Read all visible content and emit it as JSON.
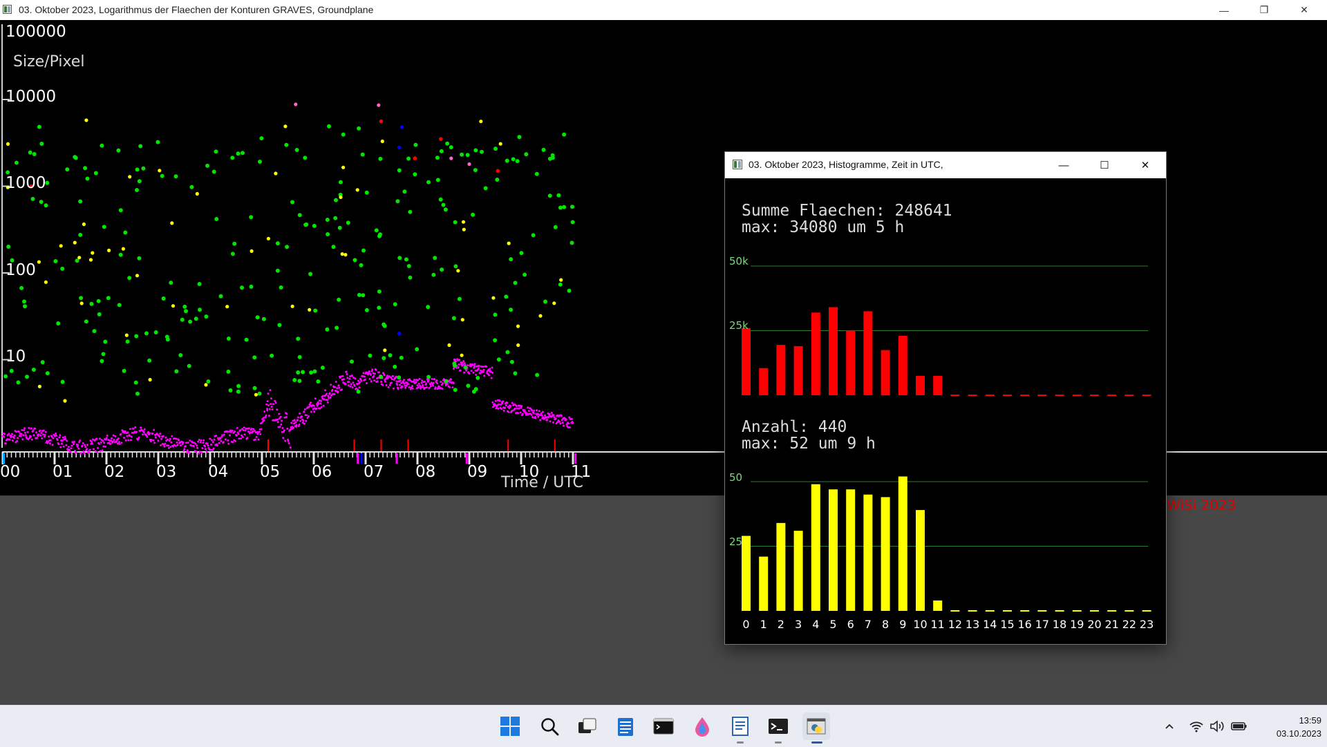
{
  "main_window": {
    "title": "03. Oktober 2023, Logarithmus der Flaechen der Konturen GRAVES, Groundplane",
    "buttons": {
      "minimize": "—",
      "restore": "❐",
      "close": "✕"
    }
  },
  "scatter_plot": {
    "y_tick_labels": [
      "100000",
      "10000",
      "1000",
      "100",
      "10"
    ],
    "y_axis_label": "Size/Pixel",
    "x_tick_labels": [
      "00",
      "01",
      "02",
      "03",
      "04",
      "05",
      "06",
      "07",
      "08",
      "09",
      "10",
      "11"
    ],
    "x_axis_label": "Time  /  UTC",
    "credit": "WiSi 2023",
    "colors": {
      "green": "#00e600",
      "yellow": "#ffff00",
      "magenta": "#ff00ff",
      "red": "#ff0000",
      "blue": "#0000ff",
      "pink": "#ff66cc"
    }
  },
  "hist_window": {
    "title": "03. Oktober 2023, Histogramme, Zeit in UTC,",
    "buttons": {
      "minimize": "—",
      "maximize": "☐",
      "close": "✕"
    },
    "sum_text": "Summe Flaechen: 248641",
    "sum_max_text": "max: 34080 um 5 h",
    "count_text": "Anzahl: 440",
    "count_max_text": "max: 52 um 9 h",
    "area_grid_labels": [
      "50k",
      "25k"
    ],
    "count_grid_labels": [
      "50",
      "25"
    ],
    "hour_labels": [
      "0",
      "1",
      "2",
      "3",
      "4",
      "5",
      "6",
      "7",
      "8",
      "9",
      "10",
      "11",
      "12",
      "13",
      "14",
      "15",
      "16",
      "17",
      "18",
      "19",
      "20",
      "21",
      "22",
      "23"
    ]
  },
  "chart_data": [
    {
      "type": "scatter",
      "title": "03. Oktober 2023, Logarithmus der Flaechen der Konturen GRAVES, Groundplane",
      "xlabel": "Time / UTC",
      "ylabel": "Size/Pixel",
      "ylim": [
        1,
        100000
      ],
      "yscale": "log",
      "xlim": [
        0,
        11.2
      ],
      "series": [
        {
          "name": "green",
          "color": "#00e600"
        },
        {
          "name": "yellow",
          "color": "#ffff00"
        },
        {
          "name": "magenta",
          "color": "#ff00ff"
        }
      ]
    },
    {
      "type": "bar",
      "title": "Summe Flaechen: 248641",
      "categories": [
        "0",
        "1",
        "2",
        "3",
        "4",
        "5",
        "6",
        "7",
        "8",
        "9",
        "10",
        "11",
        "12",
        "13",
        "14",
        "15",
        "16",
        "17",
        "18",
        "19",
        "20",
        "21",
        "22",
        "23"
      ],
      "values": [
        26000,
        10500,
        19500,
        19000,
        32000,
        34080,
        25000,
        32500,
        17500,
        23000,
        7500,
        7500,
        0,
        0,
        0,
        0,
        0,
        0,
        0,
        0,
        0,
        0,
        0,
        0
      ],
      "ylim": [
        0,
        50000
      ],
      "color": "#ff0000"
    },
    {
      "type": "bar",
      "title": "Anzahl: 440",
      "categories": [
        "0",
        "1",
        "2",
        "3",
        "4",
        "5",
        "6",
        "7",
        "8",
        "9",
        "10",
        "11",
        "12",
        "13",
        "14",
        "15",
        "16",
        "17",
        "18",
        "19",
        "20",
        "21",
        "22",
        "23"
      ],
      "values": [
        29,
        21,
        34,
        31,
        49,
        47,
        47,
        45,
        44,
        52,
        39,
        4,
        0,
        0,
        0,
        0,
        0,
        0,
        0,
        0,
        0,
        0,
        0,
        0
      ],
      "ylim": [
        0,
        50
      ],
      "color": "#ffff00"
    }
  ],
  "taskbar": {
    "apps": [
      "start-icon",
      "search-icon",
      "task-view-icon",
      "notepad-icon",
      "terminal-icon",
      "paint-icon",
      "wordpad-icon",
      "powershell-icon",
      "python-icon"
    ],
    "clock_time": "13:59",
    "clock_date": "03.10.2023"
  }
}
